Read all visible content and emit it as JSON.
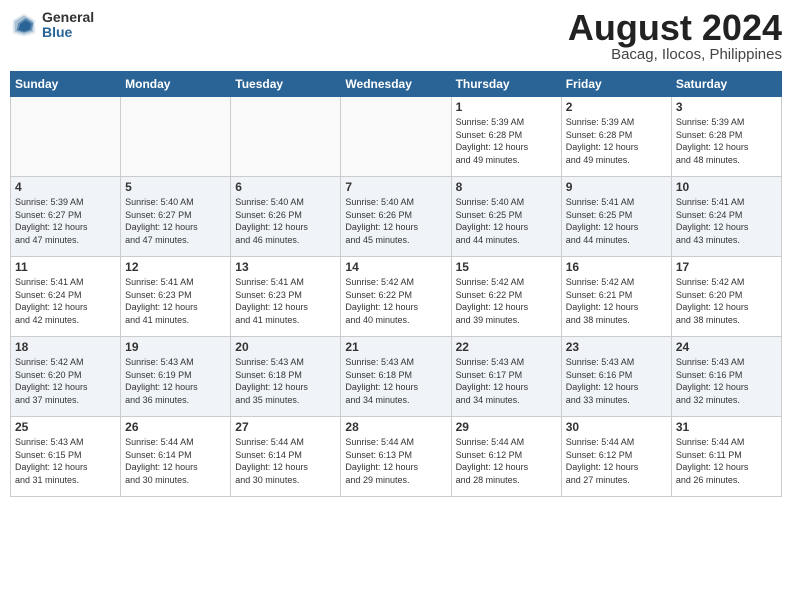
{
  "header": {
    "logo_general": "General",
    "logo_blue": "Blue",
    "month": "August 2024",
    "location": "Bacag, Ilocos, Philippines"
  },
  "weekdays": [
    "Sunday",
    "Monday",
    "Tuesday",
    "Wednesday",
    "Thursday",
    "Friday",
    "Saturday"
  ],
  "weeks": [
    [
      {
        "day": "",
        "info": ""
      },
      {
        "day": "",
        "info": ""
      },
      {
        "day": "",
        "info": ""
      },
      {
        "day": "",
        "info": ""
      },
      {
        "day": "1",
        "info": "Sunrise: 5:39 AM\nSunset: 6:28 PM\nDaylight: 12 hours\nand 49 minutes."
      },
      {
        "day": "2",
        "info": "Sunrise: 5:39 AM\nSunset: 6:28 PM\nDaylight: 12 hours\nand 49 minutes."
      },
      {
        "day": "3",
        "info": "Sunrise: 5:39 AM\nSunset: 6:28 PM\nDaylight: 12 hours\nand 48 minutes."
      }
    ],
    [
      {
        "day": "4",
        "info": "Sunrise: 5:39 AM\nSunset: 6:27 PM\nDaylight: 12 hours\nand 47 minutes."
      },
      {
        "day": "5",
        "info": "Sunrise: 5:40 AM\nSunset: 6:27 PM\nDaylight: 12 hours\nand 47 minutes."
      },
      {
        "day": "6",
        "info": "Sunrise: 5:40 AM\nSunset: 6:26 PM\nDaylight: 12 hours\nand 46 minutes."
      },
      {
        "day": "7",
        "info": "Sunrise: 5:40 AM\nSunset: 6:26 PM\nDaylight: 12 hours\nand 45 minutes."
      },
      {
        "day": "8",
        "info": "Sunrise: 5:40 AM\nSunset: 6:25 PM\nDaylight: 12 hours\nand 44 minutes."
      },
      {
        "day": "9",
        "info": "Sunrise: 5:41 AM\nSunset: 6:25 PM\nDaylight: 12 hours\nand 44 minutes."
      },
      {
        "day": "10",
        "info": "Sunrise: 5:41 AM\nSunset: 6:24 PM\nDaylight: 12 hours\nand 43 minutes."
      }
    ],
    [
      {
        "day": "11",
        "info": "Sunrise: 5:41 AM\nSunset: 6:24 PM\nDaylight: 12 hours\nand 42 minutes."
      },
      {
        "day": "12",
        "info": "Sunrise: 5:41 AM\nSunset: 6:23 PM\nDaylight: 12 hours\nand 41 minutes."
      },
      {
        "day": "13",
        "info": "Sunrise: 5:41 AM\nSunset: 6:23 PM\nDaylight: 12 hours\nand 41 minutes."
      },
      {
        "day": "14",
        "info": "Sunrise: 5:42 AM\nSunset: 6:22 PM\nDaylight: 12 hours\nand 40 minutes."
      },
      {
        "day": "15",
        "info": "Sunrise: 5:42 AM\nSunset: 6:22 PM\nDaylight: 12 hours\nand 39 minutes."
      },
      {
        "day": "16",
        "info": "Sunrise: 5:42 AM\nSunset: 6:21 PM\nDaylight: 12 hours\nand 38 minutes."
      },
      {
        "day": "17",
        "info": "Sunrise: 5:42 AM\nSunset: 6:20 PM\nDaylight: 12 hours\nand 38 minutes."
      }
    ],
    [
      {
        "day": "18",
        "info": "Sunrise: 5:42 AM\nSunset: 6:20 PM\nDaylight: 12 hours\nand 37 minutes."
      },
      {
        "day": "19",
        "info": "Sunrise: 5:43 AM\nSunset: 6:19 PM\nDaylight: 12 hours\nand 36 minutes."
      },
      {
        "day": "20",
        "info": "Sunrise: 5:43 AM\nSunset: 6:18 PM\nDaylight: 12 hours\nand 35 minutes."
      },
      {
        "day": "21",
        "info": "Sunrise: 5:43 AM\nSunset: 6:18 PM\nDaylight: 12 hours\nand 34 minutes."
      },
      {
        "day": "22",
        "info": "Sunrise: 5:43 AM\nSunset: 6:17 PM\nDaylight: 12 hours\nand 34 minutes."
      },
      {
        "day": "23",
        "info": "Sunrise: 5:43 AM\nSunset: 6:16 PM\nDaylight: 12 hours\nand 33 minutes."
      },
      {
        "day": "24",
        "info": "Sunrise: 5:43 AM\nSunset: 6:16 PM\nDaylight: 12 hours\nand 32 minutes."
      }
    ],
    [
      {
        "day": "25",
        "info": "Sunrise: 5:43 AM\nSunset: 6:15 PM\nDaylight: 12 hours\nand 31 minutes."
      },
      {
        "day": "26",
        "info": "Sunrise: 5:44 AM\nSunset: 6:14 PM\nDaylight: 12 hours\nand 30 minutes."
      },
      {
        "day": "27",
        "info": "Sunrise: 5:44 AM\nSunset: 6:14 PM\nDaylight: 12 hours\nand 30 minutes."
      },
      {
        "day": "28",
        "info": "Sunrise: 5:44 AM\nSunset: 6:13 PM\nDaylight: 12 hours\nand 29 minutes."
      },
      {
        "day": "29",
        "info": "Sunrise: 5:44 AM\nSunset: 6:12 PM\nDaylight: 12 hours\nand 28 minutes."
      },
      {
        "day": "30",
        "info": "Sunrise: 5:44 AM\nSunset: 6:12 PM\nDaylight: 12 hours\nand 27 minutes."
      },
      {
        "day": "31",
        "info": "Sunrise: 5:44 AM\nSunset: 6:11 PM\nDaylight: 12 hours\nand 26 minutes."
      }
    ]
  ]
}
